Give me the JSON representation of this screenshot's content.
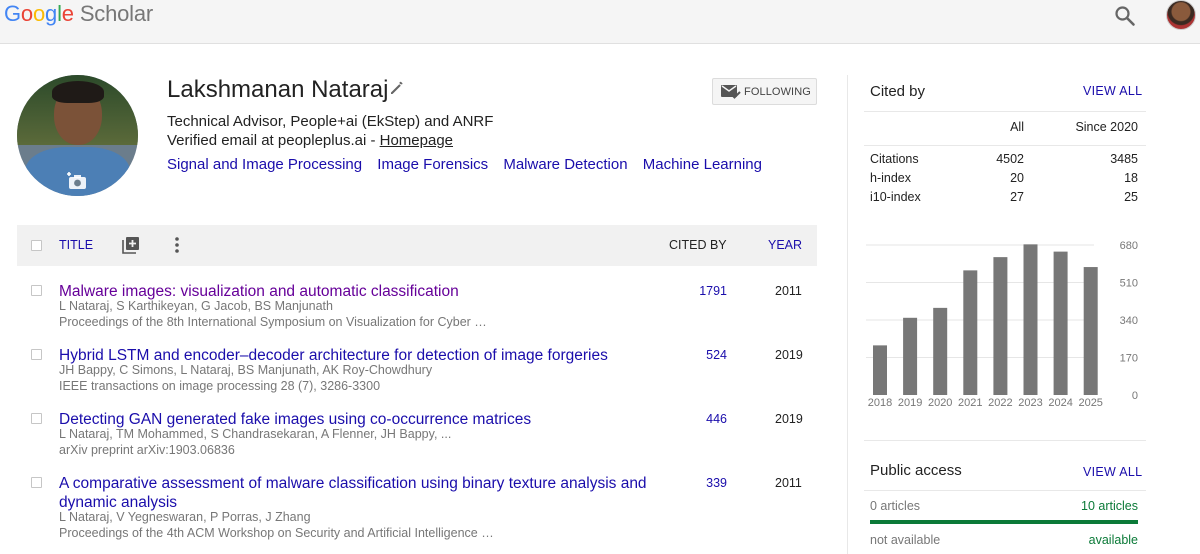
{
  "header": {
    "logo": [
      "G",
      "o",
      "o",
      "g",
      "l",
      "e"
    ],
    "logo_suffix": "Scholar"
  },
  "profile": {
    "name": "Lakshmanan Nataraj",
    "affiliation": "Technical Advisor, People+ai (EkStep) and ANRF",
    "email_text": "Verified email at peopleplus.ai - ",
    "homepage": "Homepage",
    "interests": [
      "Signal and Image Processing",
      "Image Forensics",
      "Malware Detection",
      "Machine Learning"
    ],
    "follow_label": "FOLLOWING"
  },
  "table": {
    "title_col": "TITLE",
    "cited_col": "CITED BY",
    "year_col": "YEAR",
    "articles": [
      {
        "title": "Malware images: visualization and automatic classification",
        "authors": "L Nataraj, S Karthikeyan, G Jacob, BS Manjunath",
        "venue": "Proceedings of the 8th International Symposium on Visualization for Cyber …",
        "cited": "1791",
        "year": "2011"
      },
      {
        "title": "Hybrid LSTM and encoder–decoder architecture for detection of image forgeries",
        "authors": "JH Bappy, C Simons, L Nataraj, BS Manjunath, AK Roy-Chowdhury",
        "venue": "IEEE transactions on image processing 28 (7), 3286-3300",
        "cited": "524",
        "year": "2019"
      },
      {
        "title": "Detecting GAN generated fake images using co-occurrence matrices",
        "authors": "L Nataraj, TM Mohammed, S Chandrasekaran, A Flenner, JH Bappy, ...",
        "venue": "arXiv preprint arXiv:1903.06836",
        "cited": "446",
        "year": "2019"
      },
      {
        "title": "A comparative assessment of malware classification using binary texture analysis and dynamic analysis",
        "authors": "L Nataraj, V Yegneswaran, P Porras, J Zhang",
        "venue": "Proceedings of the 4th ACM Workshop on Security and Artificial Intelligence …",
        "cited": "339",
        "year": "2011"
      }
    ]
  },
  "cited_by": {
    "title": "Cited by",
    "view_all": "VIEW ALL",
    "col_all": "All",
    "col_since": "Since 2020",
    "rows": [
      {
        "label": "Citations",
        "all": "4502",
        "since": "3485"
      },
      {
        "label": "h-index",
        "all": "20",
        "since": "18"
      },
      {
        "label": "i10-index",
        "all": "27",
        "since": "25"
      }
    ]
  },
  "chart_data": {
    "type": "bar",
    "categories": [
      "2018",
      "2019",
      "2020",
      "2021",
      "2022",
      "2023",
      "2024",
      "2025"
    ],
    "values": [
      225,
      350,
      395,
      565,
      625,
      683,
      650,
      580
    ],
    "ylim": [
      0,
      680
    ],
    "yticks": [
      0,
      170,
      340,
      510,
      680
    ],
    "bar_color": "#777777",
    "grid": true
  },
  "public_access": {
    "title": "Public access",
    "view_all": "VIEW ALL",
    "left_count": "0 articles",
    "right_count": "10 articles",
    "left_label": "not available",
    "right_label": "available",
    "available_color": "#0b7a38"
  }
}
